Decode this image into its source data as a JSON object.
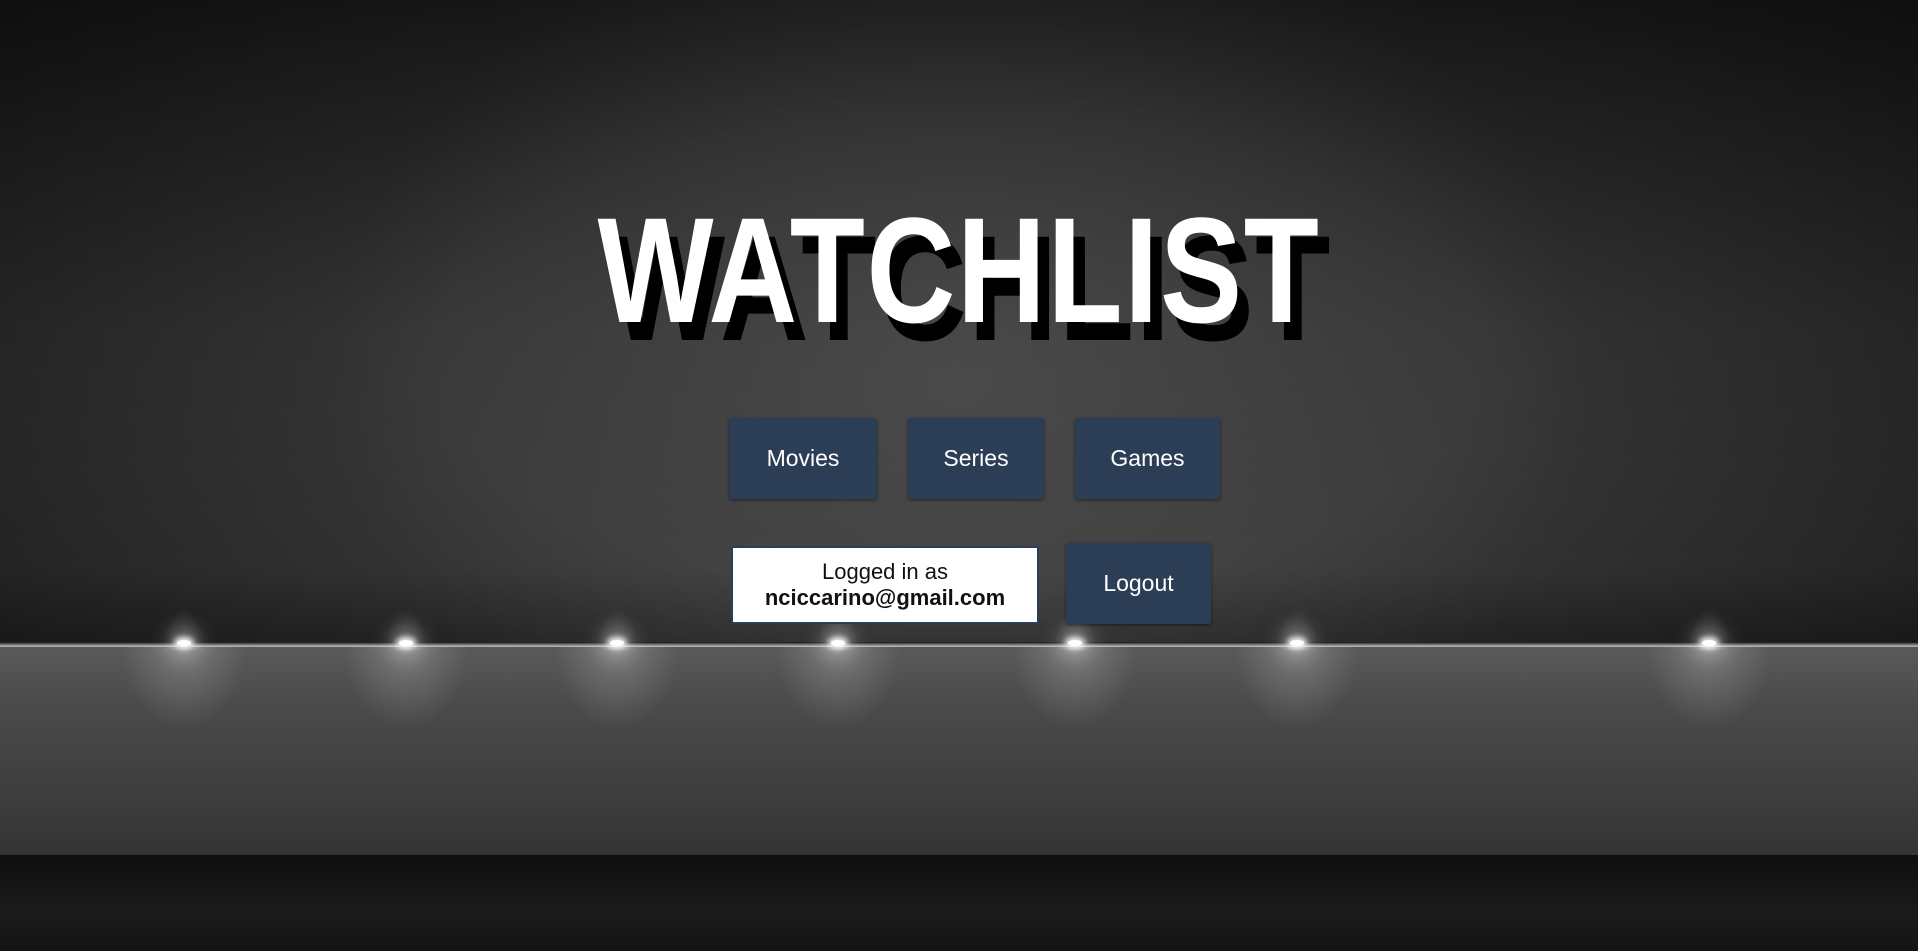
{
  "app": {
    "title": "WATCHLIST"
  },
  "nav": {
    "movies_label": "Movies",
    "series_label": "Series",
    "games_label": "Games"
  },
  "account": {
    "logged_in_label": "Logged in as",
    "email": "nciccarino@gmail.com",
    "logout_label": "Logout"
  },
  "colors": {
    "button_bg": "#2c3e56",
    "title_text": "#ffffff",
    "title_shadow": "#000000"
  }
}
